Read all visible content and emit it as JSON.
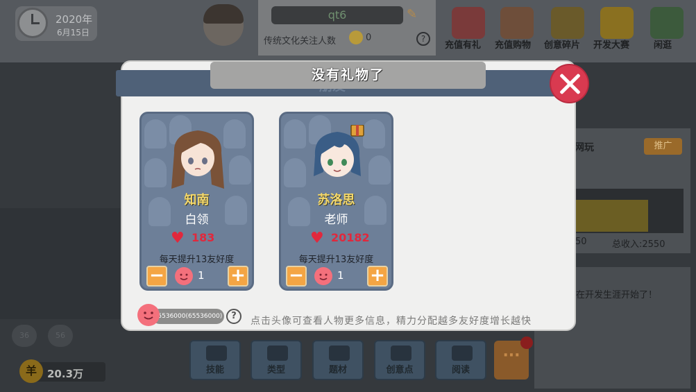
{
  "hud": {
    "date_year": "2020年",
    "date_day": "6月15日",
    "player_name": "qt6",
    "fans_label": "传统文化关注人数",
    "fans_count": "0",
    "help": "?"
  },
  "top_menu": [
    {
      "label": "充值有礼",
      "icon": "gift-box-icon",
      "color": "#7a3a3a"
    },
    {
      "label": "充值购物",
      "icon": "shop-icon",
      "color": "#6e4e3a"
    },
    {
      "label": "创意碎片",
      "icon": "gift-pieces-icon",
      "color": "#6a5a2a"
    },
    {
      "label": "开发大赛",
      "icon": "code-badge-icon",
      "color": "#8a7020"
    },
    {
      "label": "闲逛",
      "icon": "park-icon",
      "color": "#3c5a3c"
    }
  ],
  "right_panel": {
    "title": "网玩",
    "tag": "推广",
    "sum_left": "50",
    "total_income": "总收入:2550",
    "message": "在开发生涯开始了！"
  },
  "left_buttons": [
    "36",
    "56"
  ],
  "money": {
    "coin": "羊",
    "value": "20.3万"
  },
  "bottom_nav": [
    "技能",
    "类型",
    "题材",
    "创意点",
    "阅读"
  ],
  "more_button": "···",
  "modal": {
    "header_title": "朋友",
    "toast": "没有礼物了",
    "friends": [
      {
        "name": "知南",
        "job": "白领",
        "affinity": "183",
        "daily": "每天提升13友好度",
        "alloc": "1",
        "hair": "#7a5238",
        "skin": "#f7e3d6",
        "eyes": "#6a6f86"
      },
      {
        "name": "苏洛思",
        "job": "老师",
        "affinity": "20182",
        "daily": "每天提升13友好度",
        "alloc": "1",
        "hair": "#3a5d86",
        "skin": "#f8e8de",
        "eyes": "#3f8a58"
      }
    ],
    "energy_value": "65536000(65536000)",
    "help": "?",
    "hint": "点击头像可查看人物更多信息，精力分配越多友好度增长越快"
  }
}
